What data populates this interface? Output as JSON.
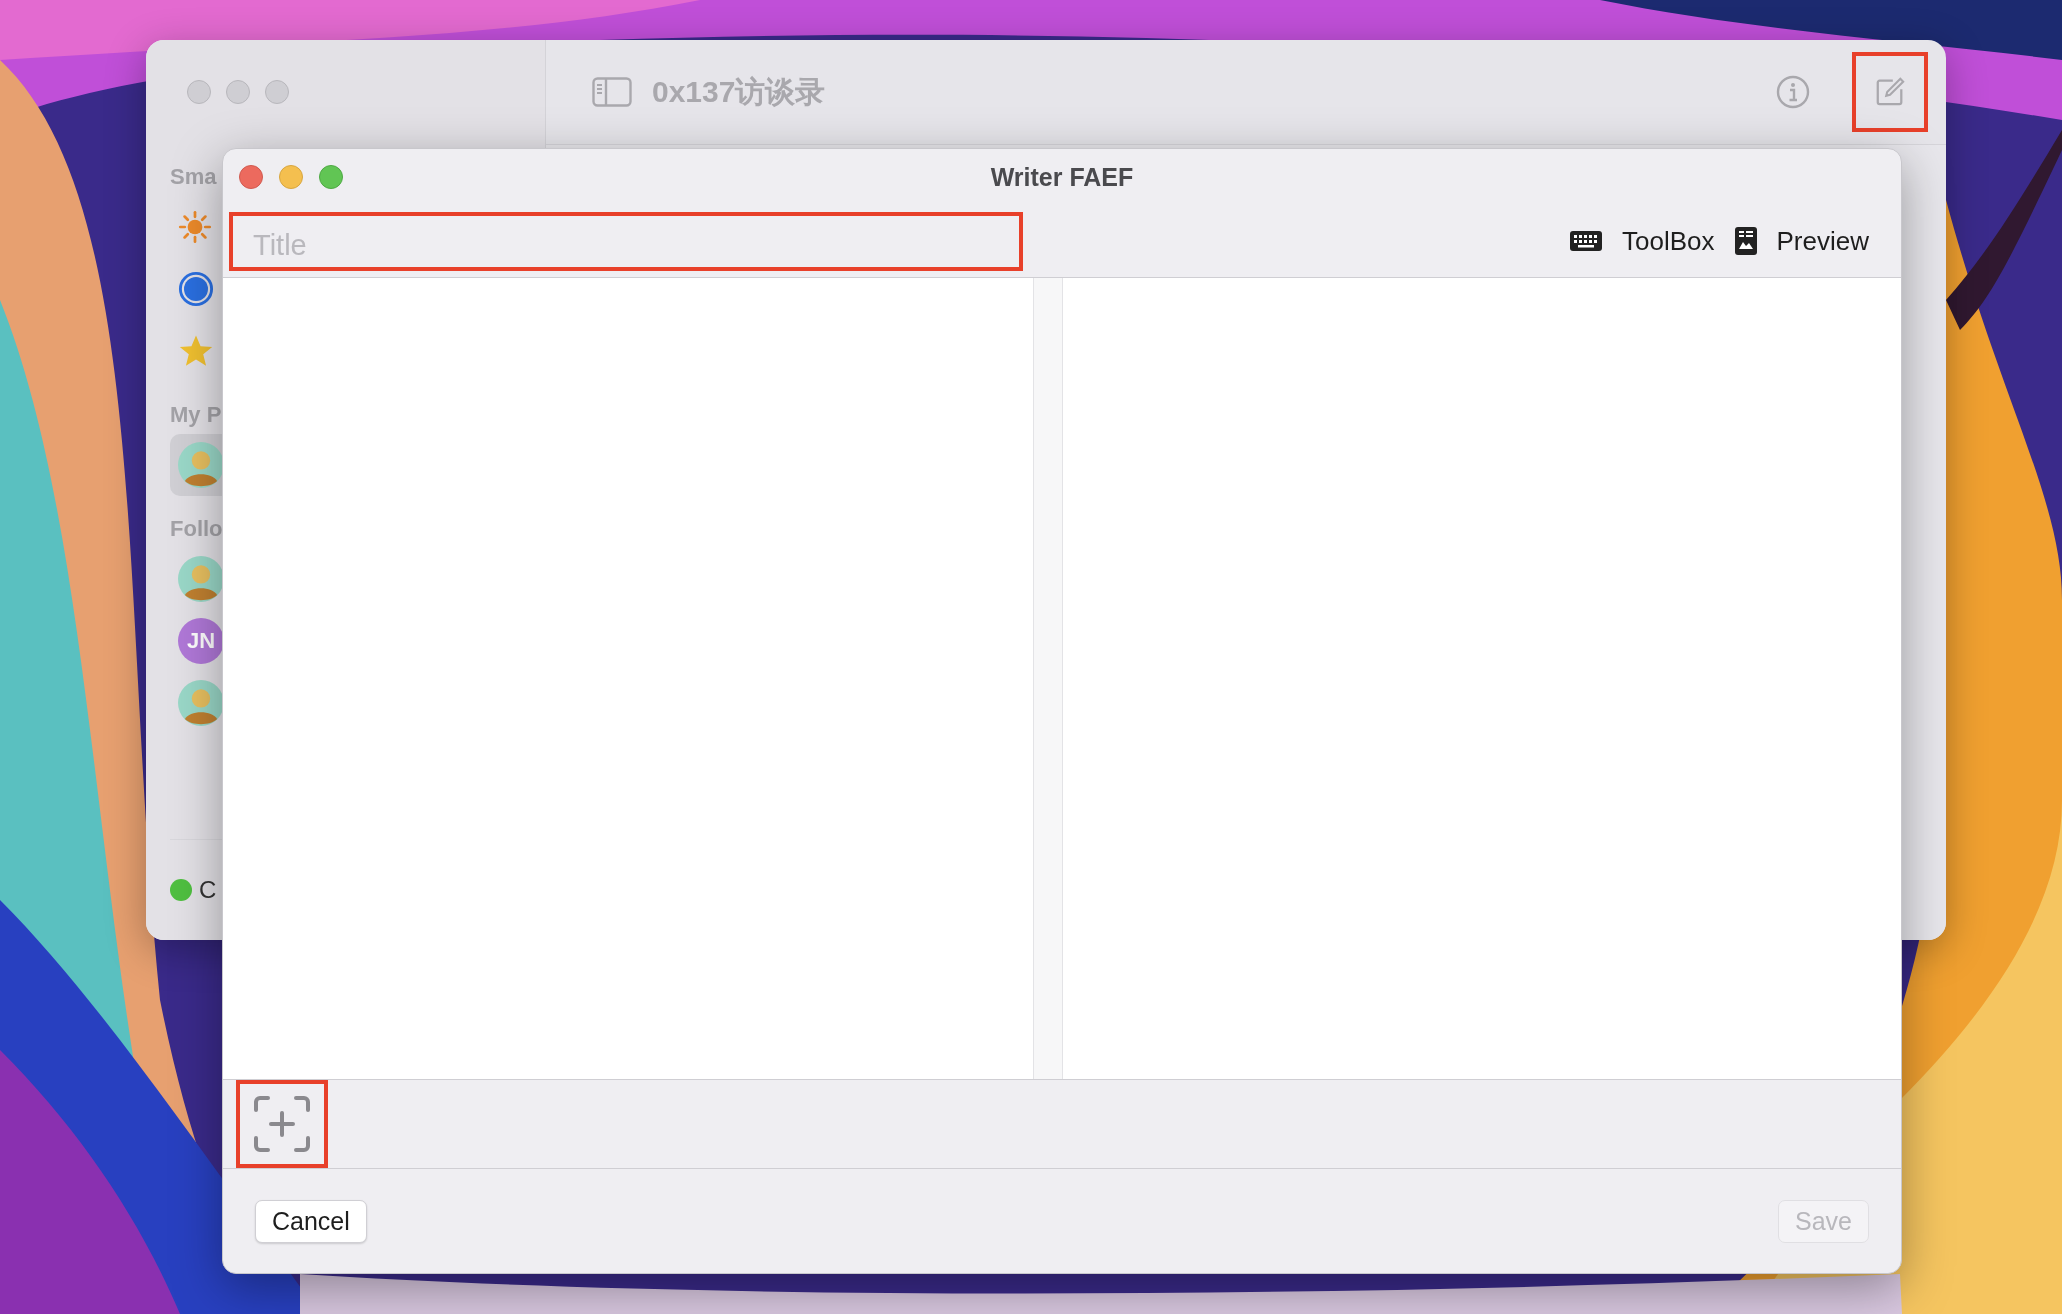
{
  "back_window": {
    "title": "0x137访谈录",
    "sidebar": {
      "sections": [
        {
          "heading": "Sma",
          "items": [
            {
              "kind": "sun",
              "selected": false
            },
            {
              "kind": "circle",
              "selected": false
            },
            {
              "kind": "star",
              "selected": false
            }
          ]
        },
        {
          "heading": "My P",
          "items": [
            {
              "kind": "avatar",
              "selected": true
            }
          ]
        },
        {
          "heading": "Follo",
          "items": [
            {
              "kind": "avatar",
              "selected": false
            },
            {
              "kind": "initials",
              "initials": "JN",
              "selected": false
            },
            {
              "kind": "avatar",
              "selected": false
            }
          ]
        }
      ],
      "status": {
        "label": "C"
      }
    }
  },
  "sheet": {
    "title": "Writer FAEF",
    "title_field": {
      "placeholder": "Title"
    },
    "toolbar": [
      {
        "kind": "keyboard",
        "label": "ToolBox"
      },
      {
        "kind": "preview",
        "label": "Preview"
      }
    ],
    "buttons": [
      {
        "label": "Cancel",
        "disabled": false
      },
      {
        "label": "Save",
        "disabled": true
      }
    ]
  }
}
